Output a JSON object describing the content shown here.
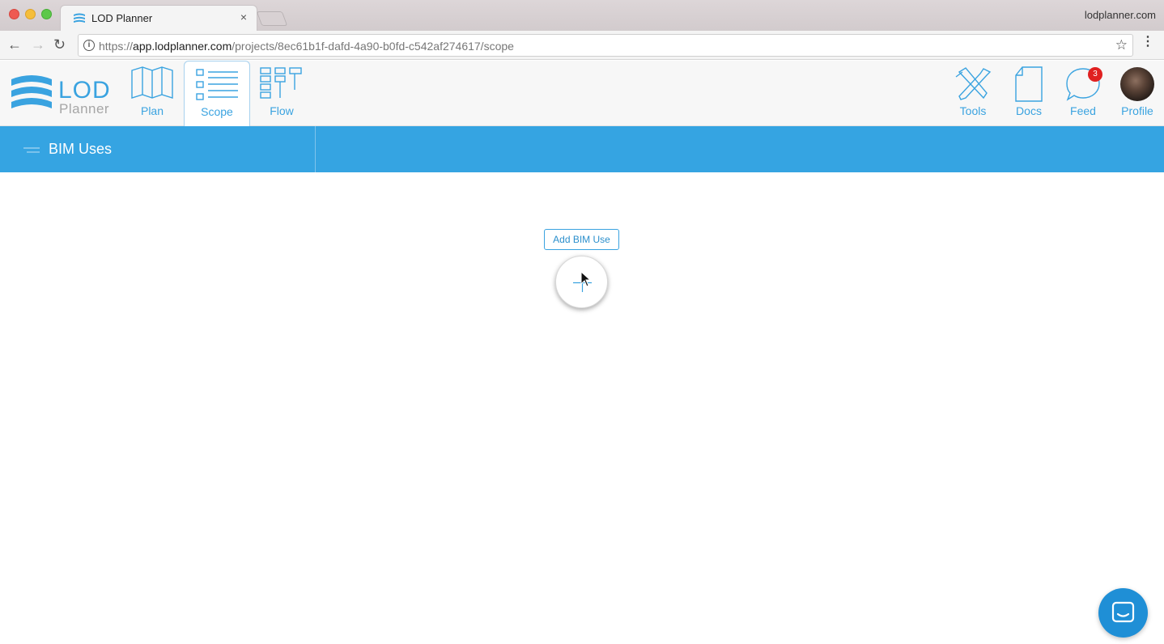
{
  "browser": {
    "tab_title": "LOD Planner",
    "tab_close": "×",
    "profile_domain": "lodplanner.com",
    "url_scheme": "https://",
    "url_host": "app.lodplanner.com",
    "url_path": "/projects/8ec61b1f-dafd-4a90-b0fd-c542af274617/scope",
    "info_glyph": "i",
    "star_glyph": "☆",
    "menu_glyph": "⋮",
    "back_glyph": "←",
    "forward_glyph": "→",
    "reload_glyph": "↻"
  },
  "logo": {
    "primary": "LOD",
    "secondary": "Planner"
  },
  "nav": {
    "plan": "Plan",
    "scope": "Scope",
    "flow": "Flow",
    "tools": "Tools",
    "docs": "Docs",
    "feed": "Feed",
    "feed_badge": "3",
    "profile": "Profile"
  },
  "section": {
    "title": "BIM Uses"
  },
  "main": {
    "add_button": "Add BIM Use"
  },
  "colors": {
    "accent": "#35a4e2",
    "badge": "#e02020",
    "chat": "#1f8fd6"
  }
}
